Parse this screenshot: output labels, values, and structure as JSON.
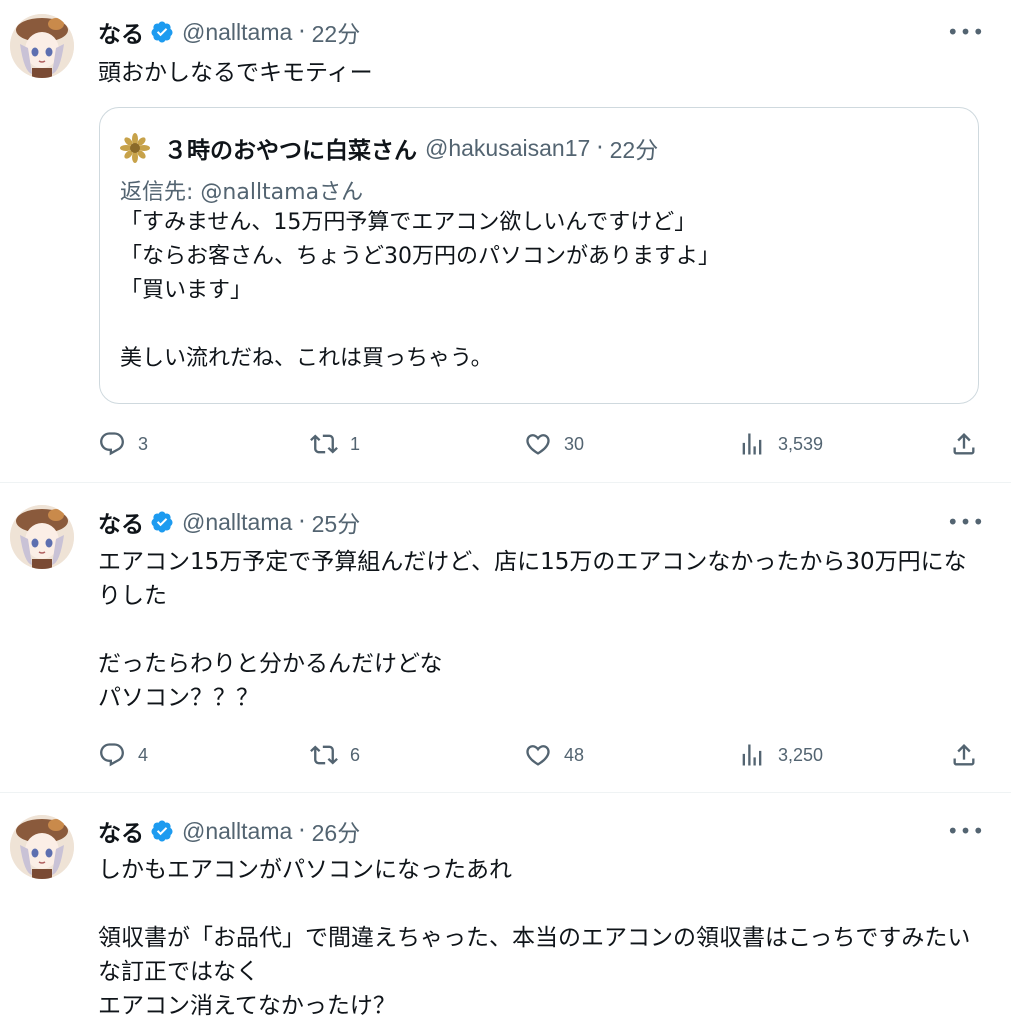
{
  "tweets": [
    {
      "name": "なる",
      "handle": "@nalltama",
      "time": "22分",
      "text": "頭おかしなるでキモティー",
      "quote": {
        "name": "３時のおやつに白菜さん",
        "handle": "@hakusaisan17",
        "time": "22分",
        "reply_to": "返信先: @nalltamaさん",
        "text": "「すみません、15万円予算でエアコン欲しいんですけど」\n「ならお客さん、ちょうど30万円のパソコンがありますよ」\n「買います」\n\n美しい流れだね、これは買っちゃう。"
      },
      "replies": "3",
      "retweets": "1",
      "likes": "30",
      "views": "3,539"
    },
    {
      "name": "なる",
      "handle": "@nalltama",
      "time": "25分",
      "text": "エアコン15万予定で予算組んだけど、店に15万のエアコンなかったから30万円になりした\n\nだったらわりと分かるんだけどな\nパソコン？？？",
      "replies": "4",
      "retweets": "6",
      "likes": "48",
      "views": "3,250"
    },
    {
      "name": "なる",
      "handle": "@nalltama",
      "time": "26分",
      "text": "しかもエアコンがパソコンになったあれ\n\n領収書が「お品代」で間違えちゃった、本当のエアコンの領収書はこっちですみたいな訂正ではなく\nエアコン消えてなかったけ？"
    }
  ],
  "separator": "·",
  "more_glyph": "•••",
  "colors": {
    "text": "#0f1419",
    "secondary": "#536471",
    "verified": "#1d9bf0",
    "border": "#cfd9de"
  }
}
